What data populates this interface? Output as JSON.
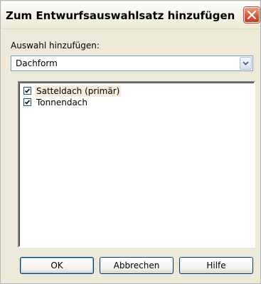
{
  "window": {
    "title": "Zum Entwurfsauswahlsatz hinzufügen"
  },
  "form": {
    "label": "Auswahl hinzufügen:",
    "select_value": "Dachform"
  },
  "list": {
    "items": [
      {
        "label": "Satteldach (primär)",
        "checked": true,
        "selected": true
      },
      {
        "label": "Tonnendach",
        "checked": true,
        "selected": false
      }
    ]
  },
  "buttons": {
    "ok": "OK",
    "cancel": "Abbrechen",
    "help": "Hilfe"
  },
  "icons": {
    "close": "close-icon",
    "dropdown": "chevron-down-icon",
    "checkmark": "checkmark-icon"
  },
  "colors": {
    "title_close_red": "#d9583a",
    "selection_highlight": "#f5ecdc",
    "field_border": "#7f9db9"
  }
}
